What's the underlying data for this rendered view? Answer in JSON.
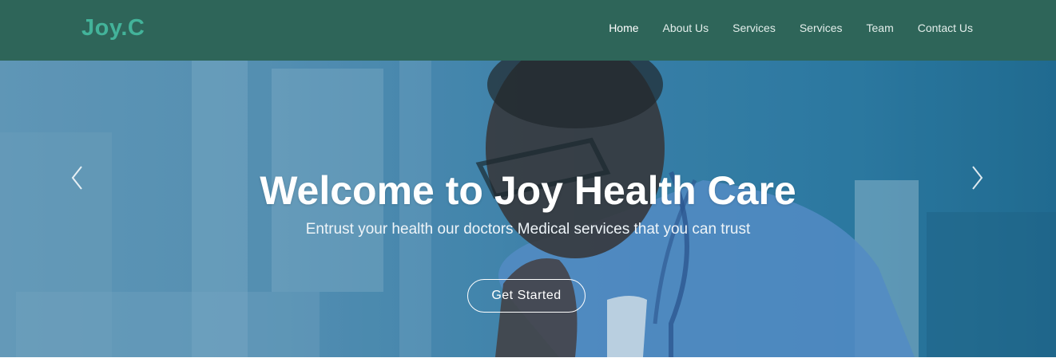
{
  "header": {
    "brand": "Joy.C",
    "nav": [
      {
        "label": "Home",
        "active": true
      },
      {
        "label": "About Us",
        "active": false
      },
      {
        "label": "Services",
        "active": false
      },
      {
        "label": "Services",
        "active": false
      },
      {
        "label": "Team",
        "active": false
      },
      {
        "label": "Contact Us",
        "active": false
      }
    ]
  },
  "hero": {
    "title": "Welcome to Joy Health Care",
    "subtitle": "Entrust your health our doctors Medical services that you can trust",
    "cta_label": "Get Started",
    "prev_icon": "chevron-left-icon",
    "next_icon": "chevron-right-icon"
  },
  "colors": {
    "navbar_bg": "#2e6559",
    "brand_text": "#43b39a",
    "nav_text": "#e3eeeb",
    "hero_tint": "#3f84ad",
    "button_border": "#ffffff"
  }
}
